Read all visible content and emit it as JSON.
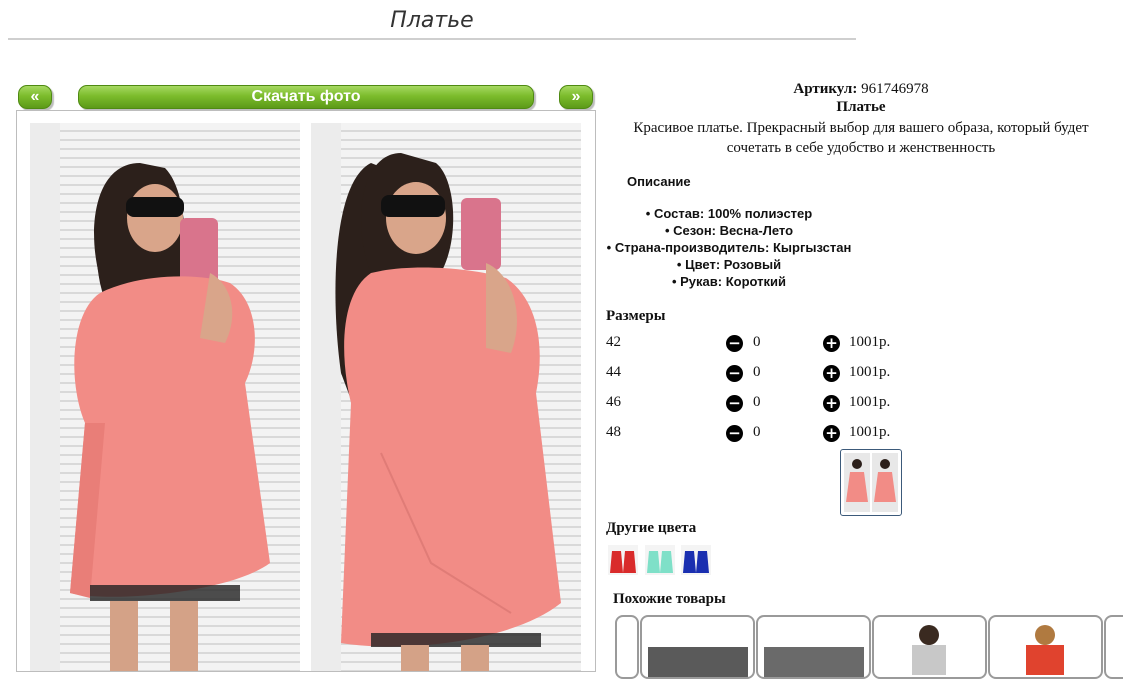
{
  "page": {
    "title": "Платье"
  },
  "gallery": {
    "prev_label": "«",
    "download_label": "Скачать фото",
    "next_label": "»"
  },
  "product": {
    "article_label": "Артикул:",
    "article_value": "961746978",
    "name": "Платье",
    "description": "Красивое платье. Прекрасный выбор для вашего образа, который будет сочетать в себе удобство и женственность",
    "description_heading": "Описание",
    "attributes": [
      "Состав: 100% полиэстер",
      "Сезон: Весна-Лето",
      "Страна-производитель: Кыргызстан",
      "Цвет: Розовый",
      "Рукав: Короткий"
    ]
  },
  "sizes": {
    "heading": "Размеры",
    "rows": [
      {
        "size": "42",
        "qty": "0",
        "price": "1001р."
      },
      {
        "size": "44",
        "qty": "0",
        "price": "1001р."
      },
      {
        "size": "46",
        "qty": "0",
        "price": "1001р."
      },
      {
        "size": "48",
        "qty": "0",
        "price": "1001р."
      }
    ]
  },
  "other_colors": {
    "heading": "Другие цвета",
    "colors": [
      "#d92b2b",
      "#7fe0c8",
      "#1a2fb0"
    ]
  },
  "similar": {
    "heading": "Похожие товары"
  },
  "colors": {
    "dress": "#f28c86",
    "accent_green": "#7cbc2c",
    "thumb_border": "#3c5a7a"
  }
}
